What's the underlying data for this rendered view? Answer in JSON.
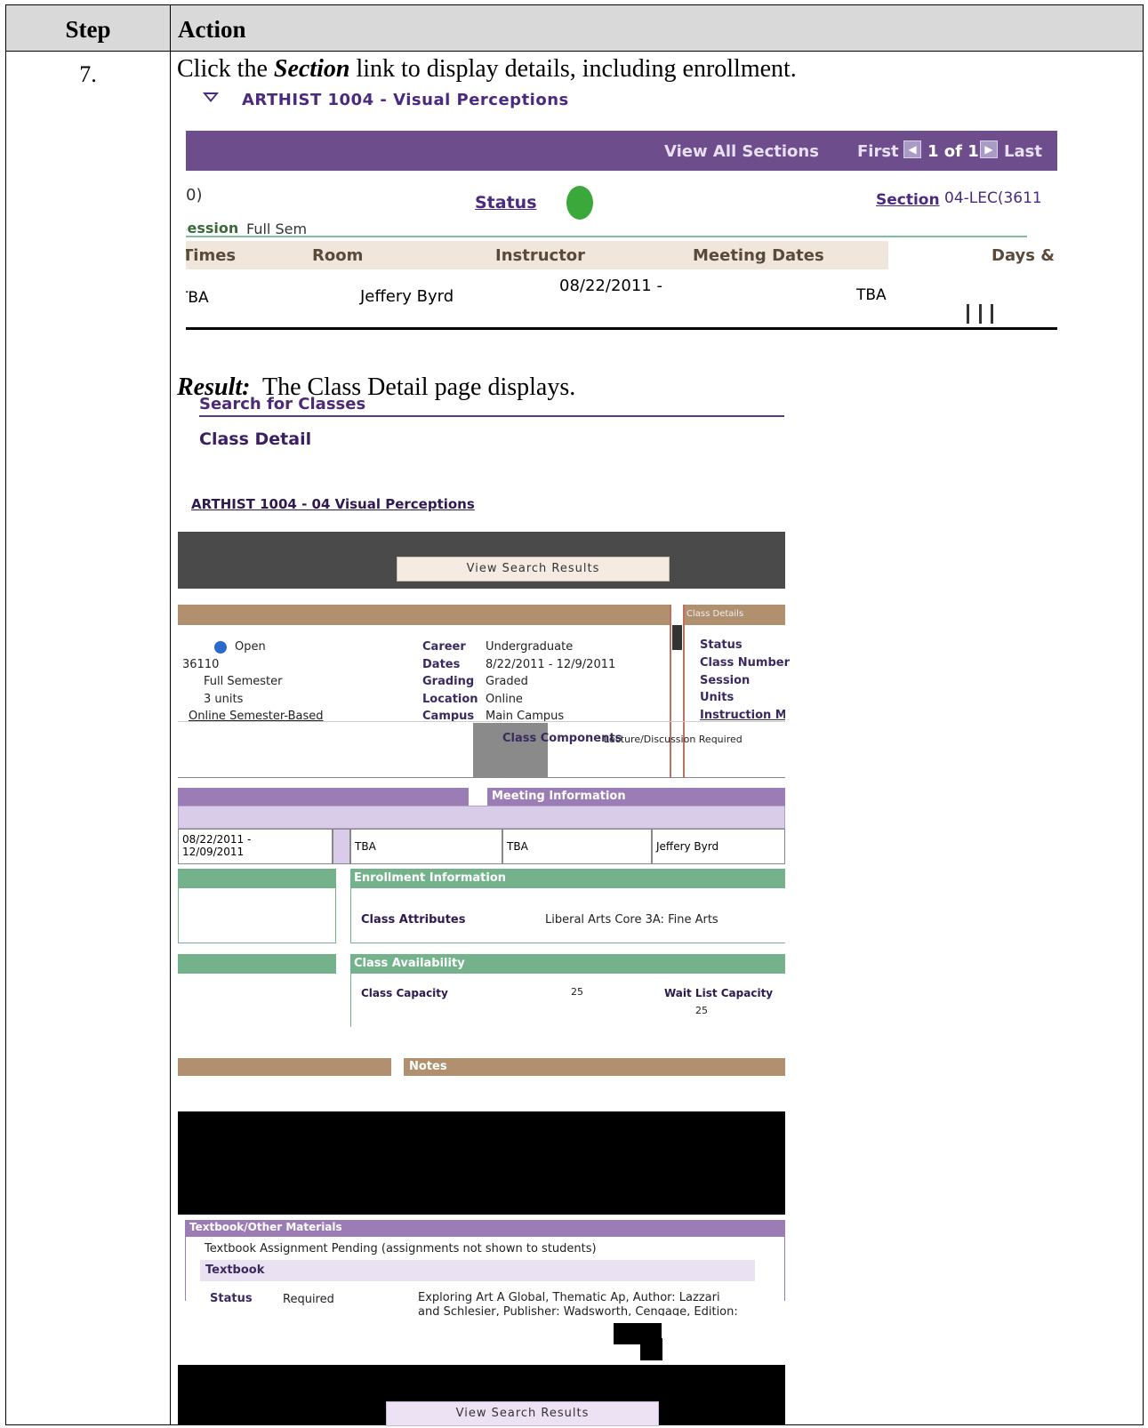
{
  "table": {
    "header_step": "Step",
    "header_action": "Action",
    "step_number": "7.",
    "instruction_pre": "Click the ",
    "instruction_em": "Section",
    "instruction_post": " link to display details, including enrollment.",
    "result_label": "Result:",
    "result_text": "  The Class Detail page displays."
  },
  "screenshot1": {
    "course_title": "ARTHIST 1004 - Visual Perceptions",
    "view_all": "View All Sections",
    "first": "First",
    "page": "1 of 1",
    "last": "Last",
    "status": "Status",
    "section_link": "Section",
    "section_value": "04-LEC(3611",
    "session_label": "Session",
    "session_value": "Full Sem",
    "cols": [
      "Times",
      "Room",
      "Instructor",
      "Meeting Dates",
      "Days &"
    ],
    "row": {
      "times": "TBA",
      "instructor": "Jeffery Byrd",
      "dates": "08/22/2011 -",
      "days": "TBA"
    }
  },
  "screenshot2": {
    "search_for_classes": "Search for Classes",
    "class_detail": "Class Detail",
    "course_title": "ARTHIST 1004 - 04  Visual Perceptions",
    "view_search_results": "View Search Results",
    "class_details_tab": "Class Details",
    "left_values": [
      "Open",
      "36110",
      "Full Semester",
      "3 units",
      "Online Semester-Based"
    ],
    "mid_labels": [
      "Career",
      "Dates",
      "Grading",
      "Location",
      "Campus"
    ],
    "mid_values": [
      "Undergraduate",
      "8/22/2011 - 12/9/2011",
      "Graded",
      "Online",
      "Main Campus"
    ],
    "right_labels": [
      "Status",
      "Class Number",
      "Session",
      "Units",
      "Instruction Mode"
    ],
    "class_components_label": "Class Components",
    "class_components_value": "Lecture/Discussion Required",
    "meeting_information": "Meeting Information",
    "meeting_row": {
      "dates": "08/22/2011 -\n12/09/2011",
      "days": "TBA",
      "room": "TBA",
      "instructor": "Jeffery Byrd"
    },
    "enrollment_information": "Enrollment Information",
    "class_attributes_label": "Class Attributes",
    "class_attributes_value": "Liberal Arts Core 3A: Fine Arts",
    "class_availability": "Class Availability",
    "class_capacity_label": "Class Capacity",
    "class_capacity_value": "25",
    "wait_list_label": "Wait List Capacity",
    "enrolled_value": "25",
    "notes": "Notes",
    "textbook_header": "Textbook/Other Materials",
    "textbook_pending": "Textbook Assignment Pending  (assignments not shown to students)",
    "textbook_label": "Textbook",
    "tb_status_label": "Status",
    "tb_status_value": "Required",
    "tb_desc_1": "Exploring Art  A Global, Thematic Ap, Author: Lazzari",
    "tb_desc_2": "and Schlesier, Publisher: Wadsworth, Cengage, Edition:",
    "view_search_results_bottom": "View Search Results"
  },
  "colors": {
    "purple_bar": "#6e4d8c",
    "green_bar": "#73b28a",
    "tan_bar": "#b0906f",
    "header_gray": "#d9d9d9"
  }
}
